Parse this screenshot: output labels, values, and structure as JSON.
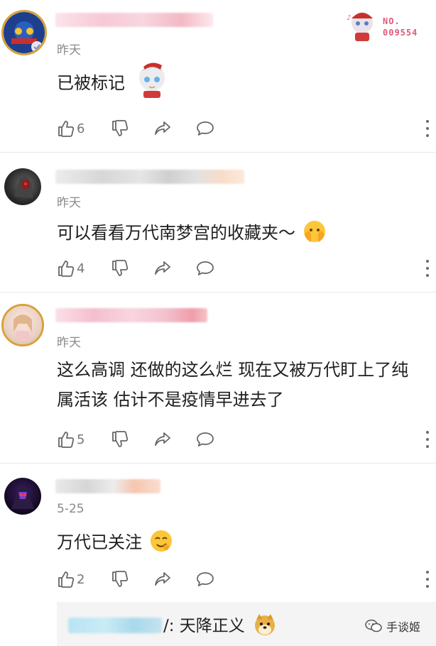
{
  "badge": {
    "line1": "NO.",
    "line2": "009554"
  },
  "comments": [
    {
      "time": "昨天",
      "text": "已被标记",
      "like_count": "6"
    },
    {
      "time": "昨天",
      "text": "可以看看万代南梦宫的收藏夹～",
      "like_count": "4"
    },
    {
      "time": "昨天",
      "text_line1": "这么高调 还做的这么烂 现在又被万代盯上了纯",
      "text_line2": "属活该 估计不是疫情早进去了",
      "like_count": "5"
    },
    {
      "time": "5-25",
      "text": "万代已关注",
      "like_count": "2"
    }
  ],
  "reply": {
    "text": "/: 天降正义"
  },
  "watermark": {
    "label": "手谈姬"
  },
  "icons": {
    "like": "thumbs-up-icon",
    "dislike": "thumbs-down-icon",
    "share": "share-arrow-icon",
    "reply": "comment-bubble-icon",
    "more": "more-dots-icon"
  },
  "colors": {
    "time_gray": "#8a8a8a",
    "badge_pink": "#e0587a",
    "divider": "#e8e8e8"
  }
}
